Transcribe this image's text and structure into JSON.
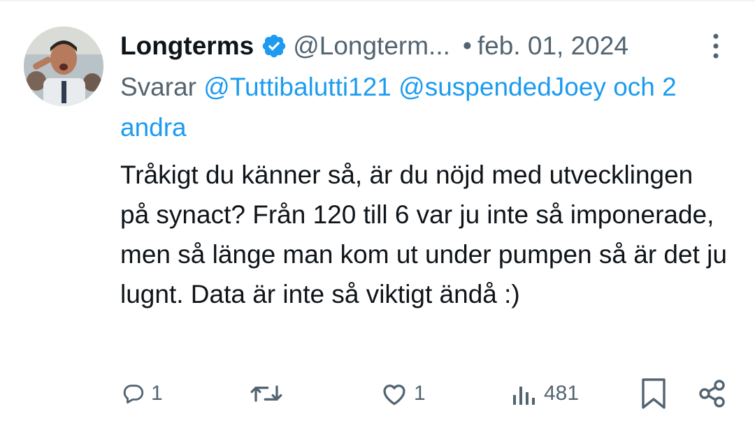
{
  "tweet": {
    "author": {
      "display_name": "Longterms",
      "handle": "@Longterm...",
      "verified": true
    },
    "separator": "•",
    "date": "feb. 01, 2024",
    "reply_to": {
      "prefix": "Svarar",
      "mention_1": "@Tuttibalutti121",
      "mention_2": "@suspendedJoey",
      "others": "och 2 andra"
    },
    "text": "Tråkigt du känner så, är du nöjd med utvecklingen på synact? Från 120 till 6 var ju inte så imponerade, men så länge man kom ut under pumpen så är det ju lugnt. Data är inte så viktigt ändå :)",
    "actions": {
      "replies": "1",
      "retweets": "",
      "likes": "1",
      "views": "481"
    }
  },
  "colors": {
    "text_primary": "#0f1419",
    "text_secondary": "#536471",
    "accent": "#1d9bf0"
  },
  "icons": [
    "verified-badge-icon",
    "more-vert-icon",
    "reply-icon",
    "retweet-icon",
    "like-icon",
    "views-icon",
    "bookmark-icon",
    "share-icon"
  ]
}
